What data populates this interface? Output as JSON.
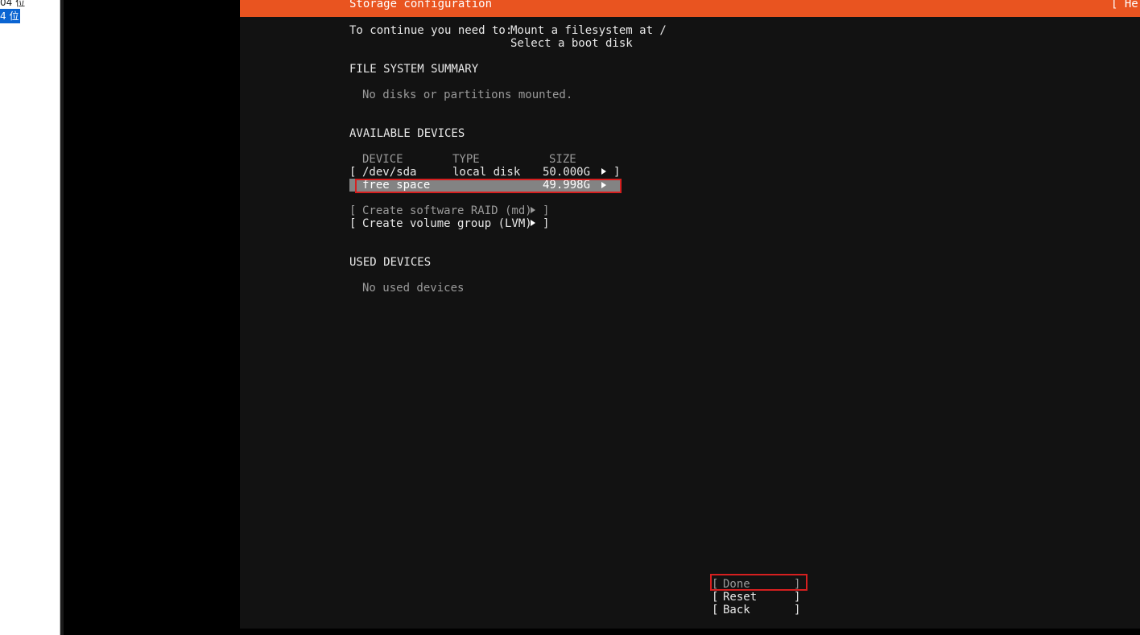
{
  "host": {
    "sidebar_row1": "04 位",
    "sidebar_row2": "4 位"
  },
  "title_bar": {
    "title": "Storage configuration",
    "help": "[ Hel"
  },
  "requirements": {
    "prefix": "To continue you need to:",
    "items": [
      "Mount a filesystem at /",
      "Select a boot disk"
    ]
  },
  "fs_summary": {
    "heading": "FILE SYSTEM SUMMARY",
    "empty_text": "No disks or partitions mounted."
  },
  "available": {
    "heading": "AVAILABLE DEVICES",
    "columns": {
      "device": "DEVICE",
      "type": "TYPE",
      "size": "SIZE"
    },
    "devices": [
      {
        "name": "/dev/sda",
        "type": "local disk",
        "size": "50.000G"
      }
    ],
    "free_space": {
      "label": "free space",
      "size": "49.998G"
    },
    "actions": {
      "raid": "Create software RAID (md)",
      "lvm": "Create volume group (LVM)"
    }
  },
  "used": {
    "heading": "USED DEVICES",
    "empty_text": "No used devices"
  },
  "buttons": {
    "done": "Done",
    "reset": "Reset",
    "back": "Back"
  },
  "colors": {
    "accent": "#e95420",
    "background": "#121212",
    "highlight": "#838383",
    "annotation": "#d61f1f"
  }
}
